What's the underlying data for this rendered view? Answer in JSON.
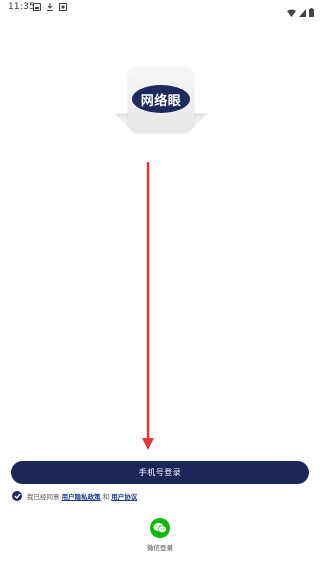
{
  "status_bar": {
    "time": "11:35",
    "left_icons": [
      "photo-icon",
      "download-icon",
      "shield-icon"
    ],
    "right_icons": [
      "wifi-icon",
      "signal-icon",
      "battery-icon"
    ]
  },
  "logo": {
    "text": "网络眼",
    "brand_color": "#1c2a5e"
  },
  "annotation": {
    "arrow_color": "#e53935"
  },
  "login": {
    "phone_button_label": "手机号登录",
    "button_color": "#1c2557"
  },
  "agreement": {
    "prefix": "我已经同意 ",
    "privacy_link": "用户隐私政策",
    "connector": " 和 ",
    "user_agreement_link": "用户协议",
    "checked": true
  },
  "wechat": {
    "label": "微信登录",
    "icon": "wechat-icon",
    "color": "#09bb07"
  }
}
